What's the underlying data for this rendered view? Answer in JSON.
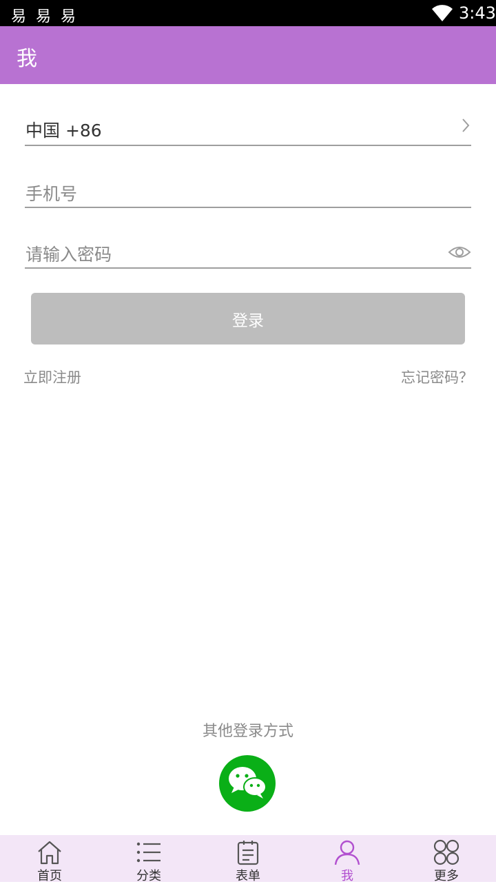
{
  "status_bar": {
    "notifications": [
      "易",
      "易",
      "易"
    ],
    "time": "3:43",
    "icons": [
      "wifi-icon"
    ]
  },
  "app_bar": {
    "title": "我"
  },
  "form": {
    "country_code": "中国 +86",
    "phone_placeholder": "手机号",
    "password_placeholder": "请输入密码",
    "login_button": "登录",
    "register_link": "立即注册",
    "forgot_link": "忘记密码？"
  },
  "other_login": {
    "label": "其他登录方式",
    "icon": "wechat-icon"
  },
  "tab_bar": {
    "items": [
      {
        "label": "首页",
        "icon": "home-icon",
        "active": false
      },
      {
        "label": "分类",
        "icon": "list-icon",
        "active": false
      },
      {
        "label": "表单",
        "icon": "clipboard-icon",
        "active": false
      },
      {
        "label": "我",
        "icon": "person-icon",
        "active": true
      },
      {
        "label": "更多",
        "icon": "grid-icon",
        "active": false
      }
    ]
  },
  "colors": {
    "accent": "#b872d2",
    "tab_active": "#b14fcf",
    "wechat": "#0aaf17",
    "button_disabled": "#bdbdbd"
  }
}
